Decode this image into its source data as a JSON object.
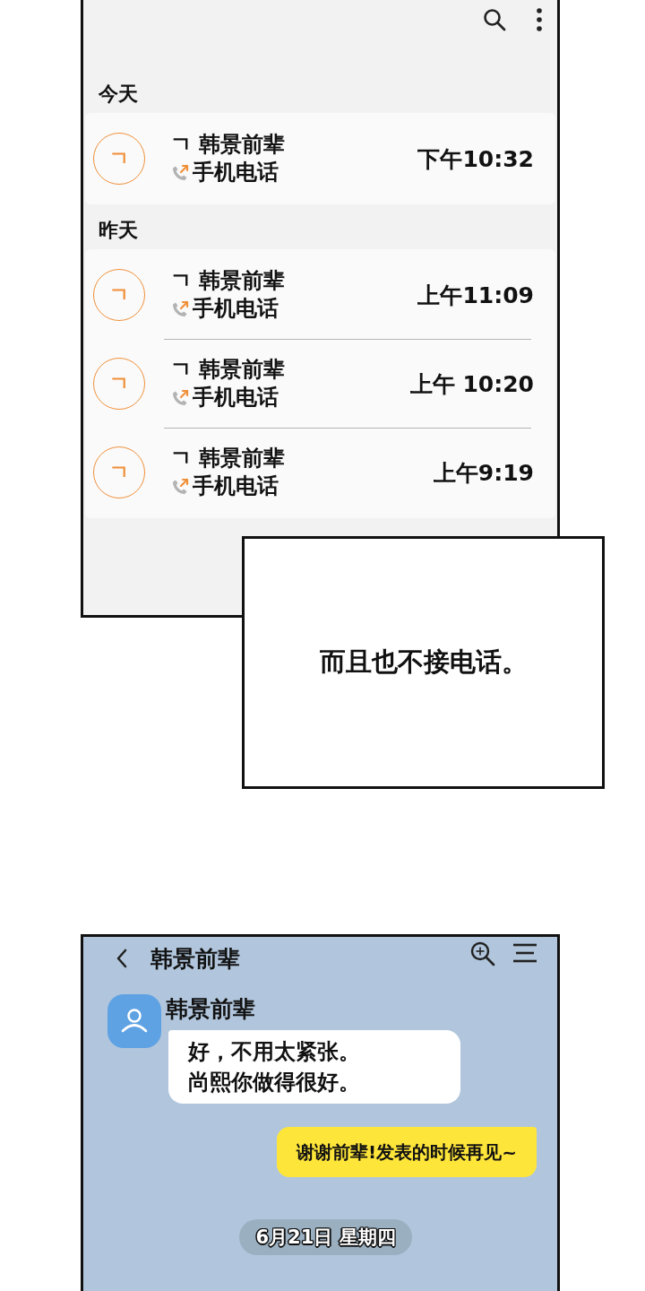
{
  "call_log": {
    "sections": [
      {
        "heading": "今天",
        "calls": [
          {
            "avatar": "ㄱ",
            "name": "ㄱ 韩景前辈",
            "type": "手机电话",
            "time": "下午10:32"
          }
        ]
      },
      {
        "heading": "昨天",
        "calls": [
          {
            "avatar": "ㄱ",
            "name": "ㄱ 韩景前辈",
            "type": "手机电话",
            "time": "上午11:09"
          },
          {
            "avatar": "ㄱ",
            "name": "ㄱ 韩景前辈",
            "type": "手机电话",
            "time": "上午 10:20"
          },
          {
            "avatar": "ㄱ",
            "name": "ㄱ 韩景前辈",
            "type": "手机电话",
            "time": "上午9:19"
          }
        ]
      }
    ]
  },
  "caption": {
    "text": "而且也不接电话。"
  },
  "chat": {
    "title": "韩景前辈",
    "messages": [
      {
        "kind": "incoming",
        "sender": "韩景前辈",
        "lines": [
          "好，不用太紧张。",
          "尚熙你做得很好。"
        ]
      },
      {
        "kind": "outgoing",
        "text": "谢谢前辈!发表的时候再见~"
      },
      {
        "kind": "date",
        "text": "6月21日 星期四"
      }
    ]
  }
}
